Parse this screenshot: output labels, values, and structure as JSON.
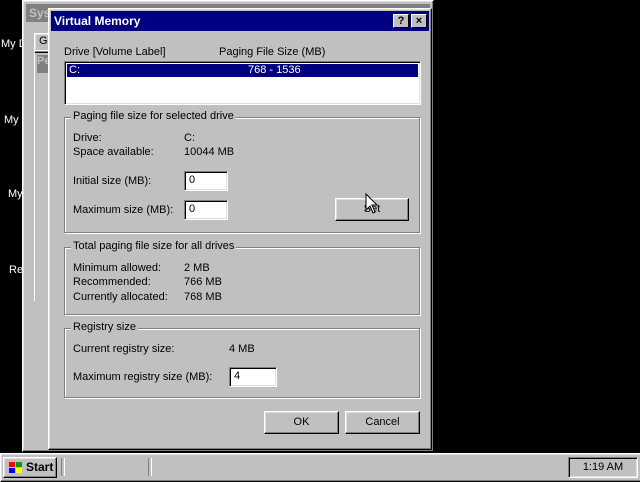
{
  "desktop": {
    "icons": [
      {
        "label": "My D"
      },
      {
        "label": "My"
      },
      {
        "label": "My"
      },
      {
        "label": "Re"
      }
    ]
  },
  "background_window": {
    "title": "Syst",
    "tab_label": "Ge",
    "sub_label": "Pe"
  },
  "dialog": {
    "title": "Virtual Memory",
    "help_button": "?",
    "close_button": "×",
    "list": {
      "header_drive": "Drive  [Volume Label]",
      "header_paging": "Paging File Size (MB)",
      "rows": [
        {
          "drive": "C:",
          "size": "768 - 1536",
          "selected": true
        }
      ]
    },
    "selected_drive_group": {
      "title": "Paging file size for selected drive",
      "drive_label": "Drive:",
      "drive_value": "C:",
      "space_label": "Space available:",
      "space_value": "10044 MB",
      "initial_label": "Initial size (MB):",
      "initial_value": "0",
      "maximum_label": "Maximum size (MB):",
      "maximum_value": "0",
      "set_button": "Set"
    },
    "total_group": {
      "title": "Total paging file size for all drives",
      "min_label": "Minimum allowed:",
      "min_value": "2 MB",
      "rec_label": "Recommended:",
      "rec_value": "766 MB",
      "cur_label": "Currently allocated:",
      "cur_value": "768 MB"
    },
    "registry_group": {
      "title": "Registry size",
      "current_label": "Current registry size:",
      "current_value": "4 MB",
      "max_label": "Maximum registry size (MB):",
      "max_value": "4"
    },
    "ok_button": "OK",
    "cancel_button": "Cancel"
  },
  "taskbar": {
    "start_label": "Start",
    "clock": "1:19 AM"
  }
}
